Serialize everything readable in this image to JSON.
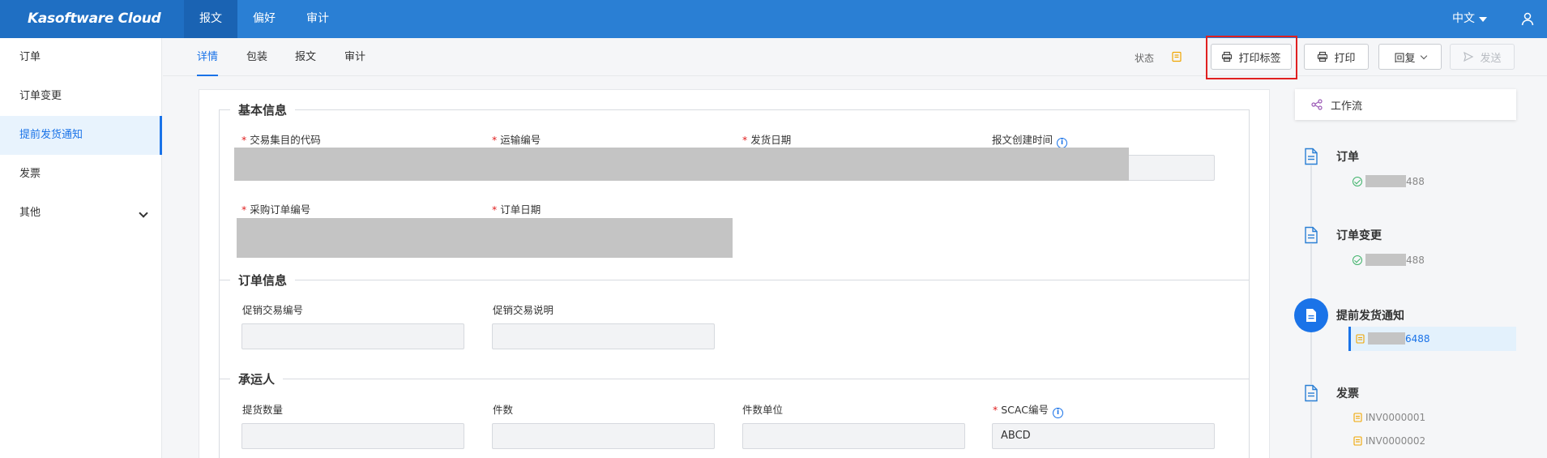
{
  "app": {
    "brand": "Kasoftware Cloud"
  },
  "topnav": {
    "items": [
      "报文",
      "偏好",
      "审计"
    ]
  },
  "lang": {
    "label": "中文"
  },
  "sidebar": {
    "items": [
      {
        "label": "订单"
      },
      {
        "label": "订单变更"
      },
      {
        "label": "提前发货通知"
      },
      {
        "label": "发票"
      },
      {
        "label": "其他"
      }
    ]
  },
  "subtabs": {
    "items": [
      "详情",
      "包装",
      "报文",
      "审计"
    ]
  },
  "toolbar": {
    "status_label": "状态",
    "print_label_button": "打印标签",
    "print_button": "打印",
    "reply_button": "回复",
    "send_button": "发送"
  },
  "sections": {
    "basic": {
      "title": "基本信息",
      "fields": [
        {
          "label": "交易集目的代码",
          "required": true
        },
        {
          "label": "运输编号",
          "required": true
        },
        {
          "label": "发货日期",
          "required": true
        },
        {
          "label": "报文创建时间",
          "required": false
        },
        {
          "label": "采购订单编号",
          "required": true
        },
        {
          "label": "订单日期",
          "required": true
        }
      ]
    },
    "order": {
      "title": "订单信息",
      "fields": [
        {
          "label": "促销交易编号"
        },
        {
          "label": "促销交易说明"
        }
      ]
    },
    "carrier": {
      "title": "承运人",
      "fields": [
        {
          "label": "提货数量"
        },
        {
          "label": "件数"
        },
        {
          "label": "件数单位"
        },
        {
          "label": "SCAC编号",
          "required": true,
          "value": "ABCD"
        }
      ]
    }
  },
  "workflow": {
    "title": "工作流",
    "nodes": [
      {
        "title": "订单",
        "sub": "488"
      },
      {
        "title": "订单变更",
        "sub": "488"
      },
      {
        "title": "提前发货通知",
        "sub": "6488"
      },
      {
        "title": "发票",
        "subs": [
          "INV0000001",
          "INV0000002"
        ]
      }
    ]
  },
  "colors": {
    "primary": "#2a7fd4",
    "accent": "#1a73e8",
    "required": "#e02020",
    "highlight": "#e02020"
  }
}
